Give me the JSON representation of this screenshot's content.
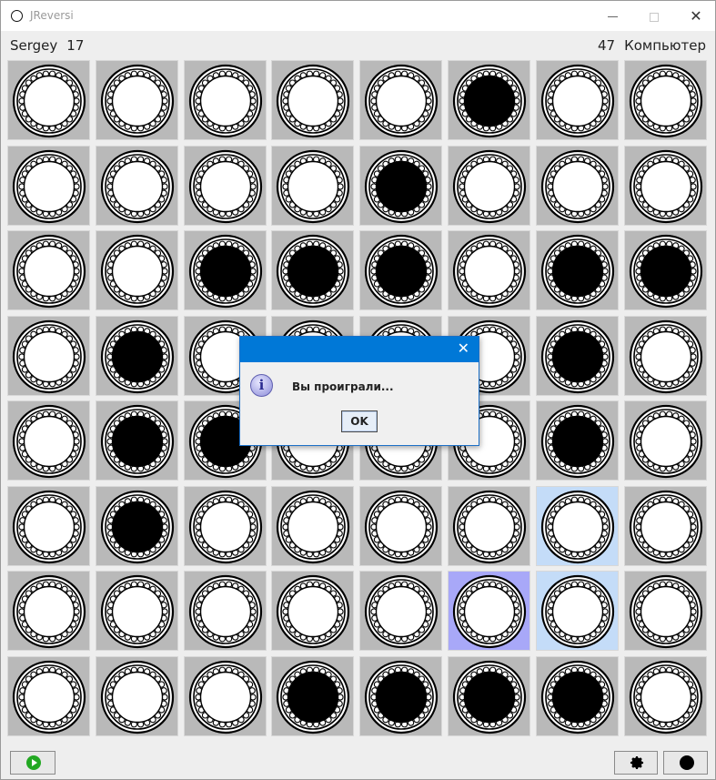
{
  "window": {
    "title": "JReversi"
  },
  "players": {
    "human": {
      "name": "Sergey",
      "score": "17"
    },
    "computer": {
      "name": "Компьютер",
      "score": "47"
    }
  },
  "board": {
    "rows": [
      [
        "white",
        "white",
        "white",
        "white",
        "white",
        "black",
        "white",
        "white"
      ],
      [
        "white",
        "white",
        "white",
        "white",
        "black",
        "white",
        "white",
        "white"
      ],
      [
        "white",
        "white",
        "black",
        "black",
        "black",
        "white",
        "black",
        "black"
      ],
      [
        "white",
        "black",
        "white",
        "white",
        "white",
        "white",
        "black",
        "white"
      ],
      [
        "white",
        "black",
        "black",
        "white",
        "white",
        "white",
        "black",
        "white"
      ],
      [
        "white",
        "black",
        "white",
        "white",
        "white",
        "white",
        "white",
        "white"
      ],
      [
        "white",
        "white",
        "white",
        "white",
        "white",
        "white",
        "white",
        "white"
      ],
      [
        "white",
        "white",
        "white",
        "black",
        "black",
        "black",
        "black",
        "white"
      ]
    ],
    "highlights": [
      {
        "row": 5,
        "col": 6,
        "style": "light-blue"
      },
      {
        "row": 6,
        "col": 5,
        "style": "violet"
      },
      {
        "row": 6,
        "col": 6,
        "style": "light-blue"
      }
    ]
  },
  "toolbar": {
    "play_icon": "play-icon",
    "settings_icon": "gear-icon",
    "color_icon": "black-disc-icon"
  },
  "dialog": {
    "icon": "info-icon",
    "message": "Вы проиграли...",
    "ok_label": "OK"
  },
  "colors": {
    "dialog_titlebar": "#0078d7",
    "cell_background": "#b9b9b9",
    "highlight_light_blue": "#c4dcf8",
    "highlight_violet": "#a8a8f8",
    "play_green": "#22a822"
  }
}
